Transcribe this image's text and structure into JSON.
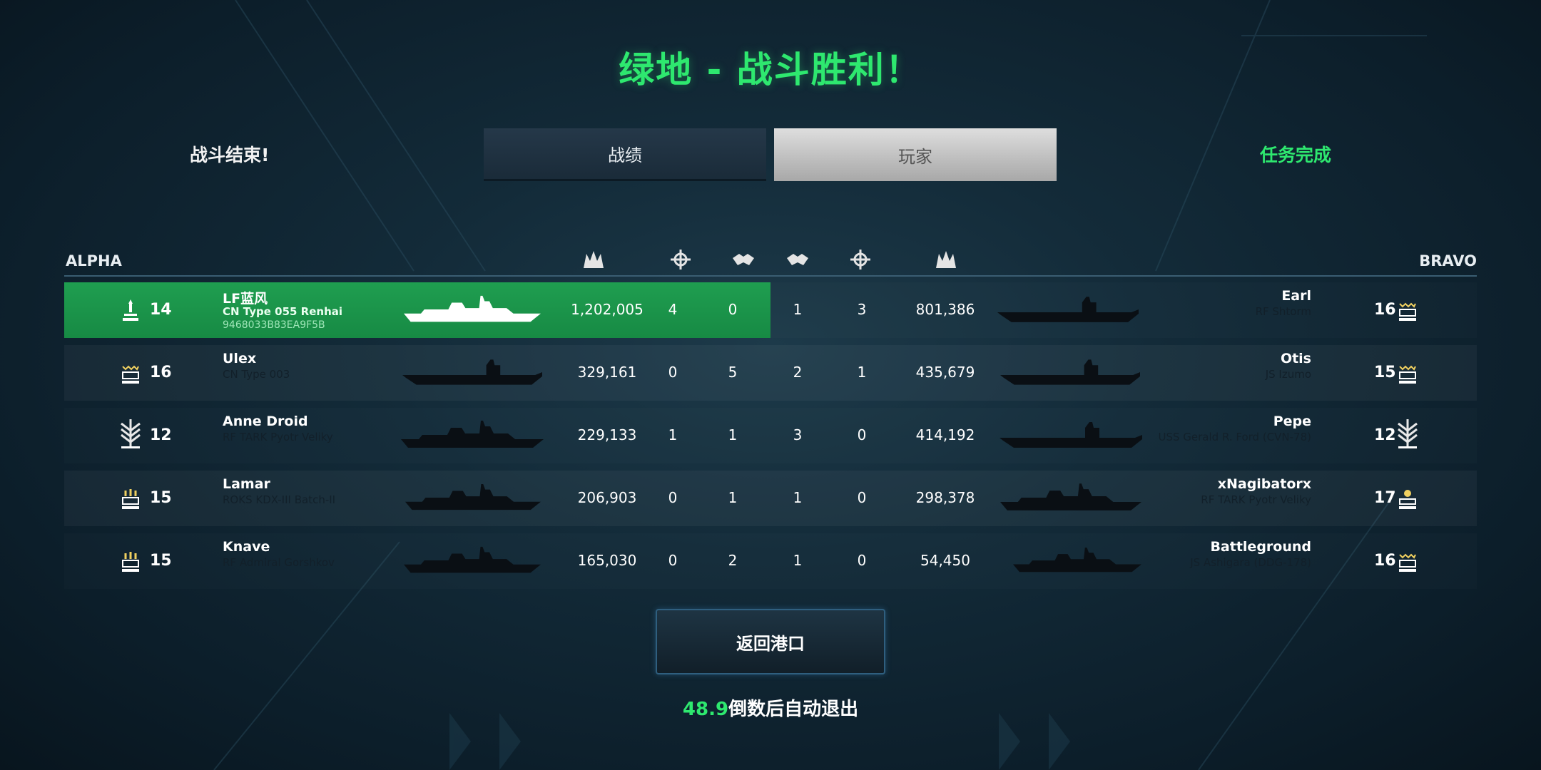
{
  "title": "绿地 - 战斗胜利！",
  "battle_status": "战斗结束!",
  "mission_status": "任务完成",
  "tabs": {
    "stats": "战绩",
    "players": "玩家"
  },
  "teams": {
    "left": "ALPHA",
    "right": "BRAVO"
  },
  "column_icons": [
    "damage-icon",
    "kill-icon",
    "assist-icon",
    "assist-icon",
    "kill-icon",
    "damage-icon"
  ],
  "rows": [
    {
      "alpha": {
        "level": "14",
        "name": "LF蓝风",
        "ship": "CN Type 055 Renhai",
        "id": "9468033B83EA9F5B",
        "damage": "1,202,005",
        "kills": "4",
        "assists": "0",
        "rank_icon": "single-bar-rank-icon",
        "highlighted": true
      },
      "bravo": {
        "level": "16",
        "name": "Earl",
        "ship": "RF Shtorm",
        "damage": "801,386",
        "kills": "3",
        "assists": "1",
        "rank_icon": "multi-chevron-rank-icon"
      }
    },
    {
      "alpha": {
        "level": "16",
        "name": "Ulex",
        "ship": "CN Type 003",
        "damage": "329,161",
        "kills": "0",
        "assists": "5",
        "rank_icon": "multi-chevron-rank-icon"
      },
      "bravo": {
        "level": "15",
        "name": "Otis",
        "ship": "JS Izumo",
        "damage": "435,679",
        "kills": "1",
        "assists": "2",
        "rank_icon": "multi-chevron-rank-icon"
      }
    },
    {
      "alpha": {
        "level": "12",
        "name": "Anne Droid",
        "ship": "RF TARK Pyotr Veliky",
        "damage": "229,133",
        "kills": "1",
        "assists": "1",
        "rank_icon": "wing-chevron-rank-icon"
      },
      "bravo": {
        "level": "12",
        "name": "Pepe",
        "ship": "USS Gerald R. Ford (CVN-78)",
        "damage": "414,192",
        "kills": "0",
        "assists": "3",
        "rank_icon": "wing-chevron-rank-icon"
      }
    },
    {
      "alpha": {
        "level": "15",
        "name": "Lamar",
        "ship": "ROKS KDX-III Batch-II",
        "damage": "206,903",
        "kills": "0",
        "assists": "1",
        "rank_icon": "triple-bar-rank-icon"
      },
      "bravo": {
        "level": "17",
        "name": "xNagibatorx",
        "ship": "RF TARK Pyotr Veliky",
        "damage": "298,378",
        "kills": "0",
        "assists": "1",
        "rank_icon": "star-bar-rank-icon"
      }
    },
    {
      "alpha": {
        "level": "15",
        "name": "Knave",
        "ship": "RF Admiral Gorshkov",
        "damage": "165,030",
        "kills": "0",
        "assists": "2",
        "rank_icon": "triple-bar-rank-icon"
      },
      "bravo": {
        "level": "16",
        "name": "Battleground",
        "ship": "JS Ashigara (DDG-178)",
        "damage": "54,450",
        "kills": "0",
        "assists": "1",
        "rank_icon": "multi-chevron-rank-icon"
      }
    }
  ],
  "back_button": "返回港口",
  "countdown": {
    "seconds": "48.9",
    "suffix": "倒数后自动退出"
  },
  "colors": {
    "accent_green": "#2ee86f",
    "highlight_row": "#1f9e50",
    "background": "#132b39"
  }
}
